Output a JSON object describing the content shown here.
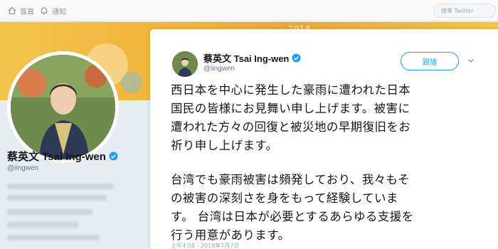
{
  "nav": {
    "home_label": "首頁",
    "notifications_label": "通知",
    "search_placeholder": "搜尋 Twitter"
  },
  "banner": {
    "year_text": "2018"
  },
  "profile": {
    "name": "蔡英文 Tsai Ing-wen",
    "handle": "@iingwen"
  },
  "tweet": {
    "name": "蔡英文 Tsai Ing-wen",
    "handle": "@iingwen",
    "follow_label": "跟隨",
    "paragraph1": [
      "西日本を中心に発生した豪雨に遭われた日本",
      "国民の皆様にお見舞い申し上げます。被害に",
      "遭われた方々の回復と被災地の早期復旧をお",
      "祈り申し上げます。"
    ],
    "paragraph2": [
      "台湾でも豪雨被害は頻発しており、我々もそ",
      "の被害の深刻さを身をもって経験していま",
      "す。 台湾は日本が必要とするあらゆる支援を",
      "行う用意があります。"
    ],
    "timestamp": "上午4:08 - 2018年7月7日"
  },
  "colors": {
    "accent": "#1da1f2",
    "banner": "#f2c44b",
    "background": "#e6ecf0"
  },
  "icons": {
    "home": "home-icon",
    "notifications": "bell-icon",
    "verified": "verified-badge-icon",
    "caret": "chevron-down-icon"
  }
}
